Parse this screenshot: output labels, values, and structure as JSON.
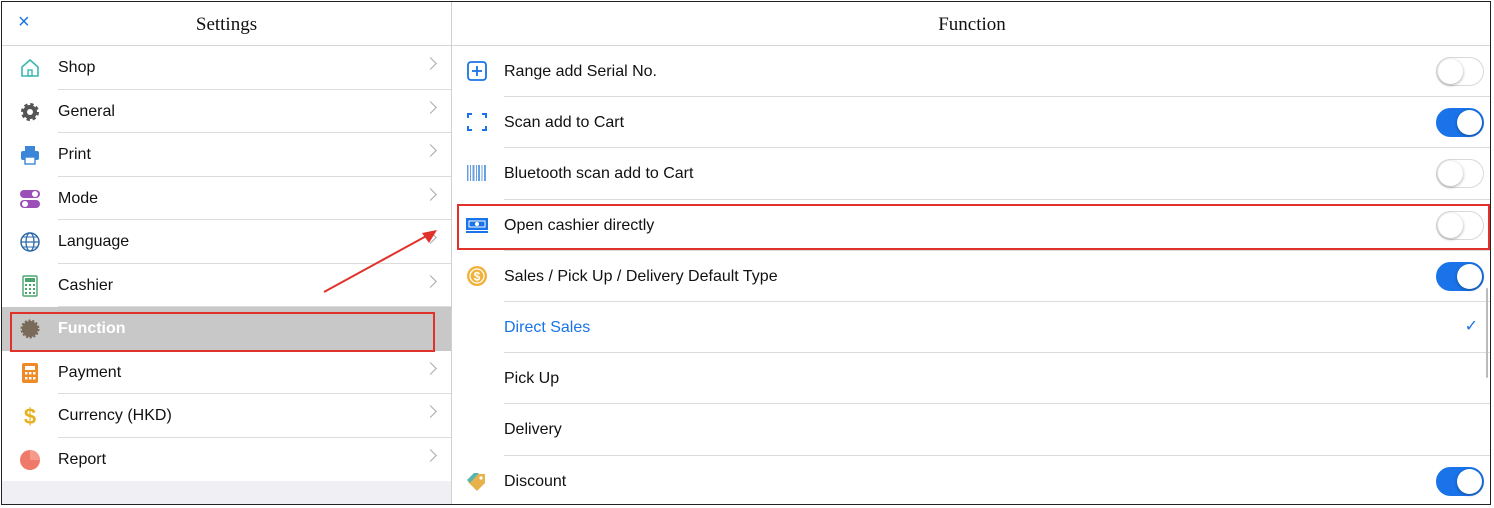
{
  "left": {
    "title": "Settings",
    "close_symbol": "×",
    "items": [
      {
        "label": "Shop",
        "icon": "shop-icon"
      },
      {
        "label": "General",
        "icon": "gear-icon"
      },
      {
        "label": "Print",
        "icon": "printer-icon"
      },
      {
        "label": "Mode",
        "icon": "toggle-mode-icon"
      },
      {
        "label": "Language",
        "icon": "globe-icon"
      },
      {
        "label": "Cashier",
        "icon": "calculator-icon"
      },
      {
        "label": "Function",
        "icon": "function-gear-icon",
        "selected": true
      },
      {
        "label": "Payment",
        "icon": "payment-calculator-icon"
      },
      {
        "label": "Currency (HKD)",
        "icon": "dollar-icon"
      },
      {
        "label": "Report",
        "icon": "pie-chart-icon"
      }
    ]
  },
  "right": {
    "title": "Function",
    "rows": [
      {
        "label": "Range add Serial No.",
        "icon": "plus-square-icon",
        "toggle": false
      },
      {
        "label": "Scan add to Cart",
        "icon": "scan-frame-icon",
        "toggle": true
      },
      {
        "label": "Bluetooth scan add to Cart",
        "icon": "barcode-icon",
        "toggle": false
      },
      {
        "label": "Open cashier directly",
        "icon": "cash-drawer-icon",
        "toggle": false
      },
      {
        "label": "Sales / Pick Up / Delivery Default Type",
        "icon": "coin-icon",
        "toggle": true
      }
    ],
    "sub_options": [
      {
        "label": "Direct Sales",
        "selected": true
      },
      {
        "label": "Pick Up",
        "selected": false
      },
      {
        "label": "Delivery",
        "selected": false
      }
    ],
    "discount": {
      "label": "Discount",
      "icon": "discount-tag-icon",
      "toggle": true
    },
    "check_symbol": "✓"
  },
  "colors": {
    "accent": "#1a73e8",
    "highlight_box": "#e0322a",
    "selected_bg": "#c8c8c8"
  }
}
